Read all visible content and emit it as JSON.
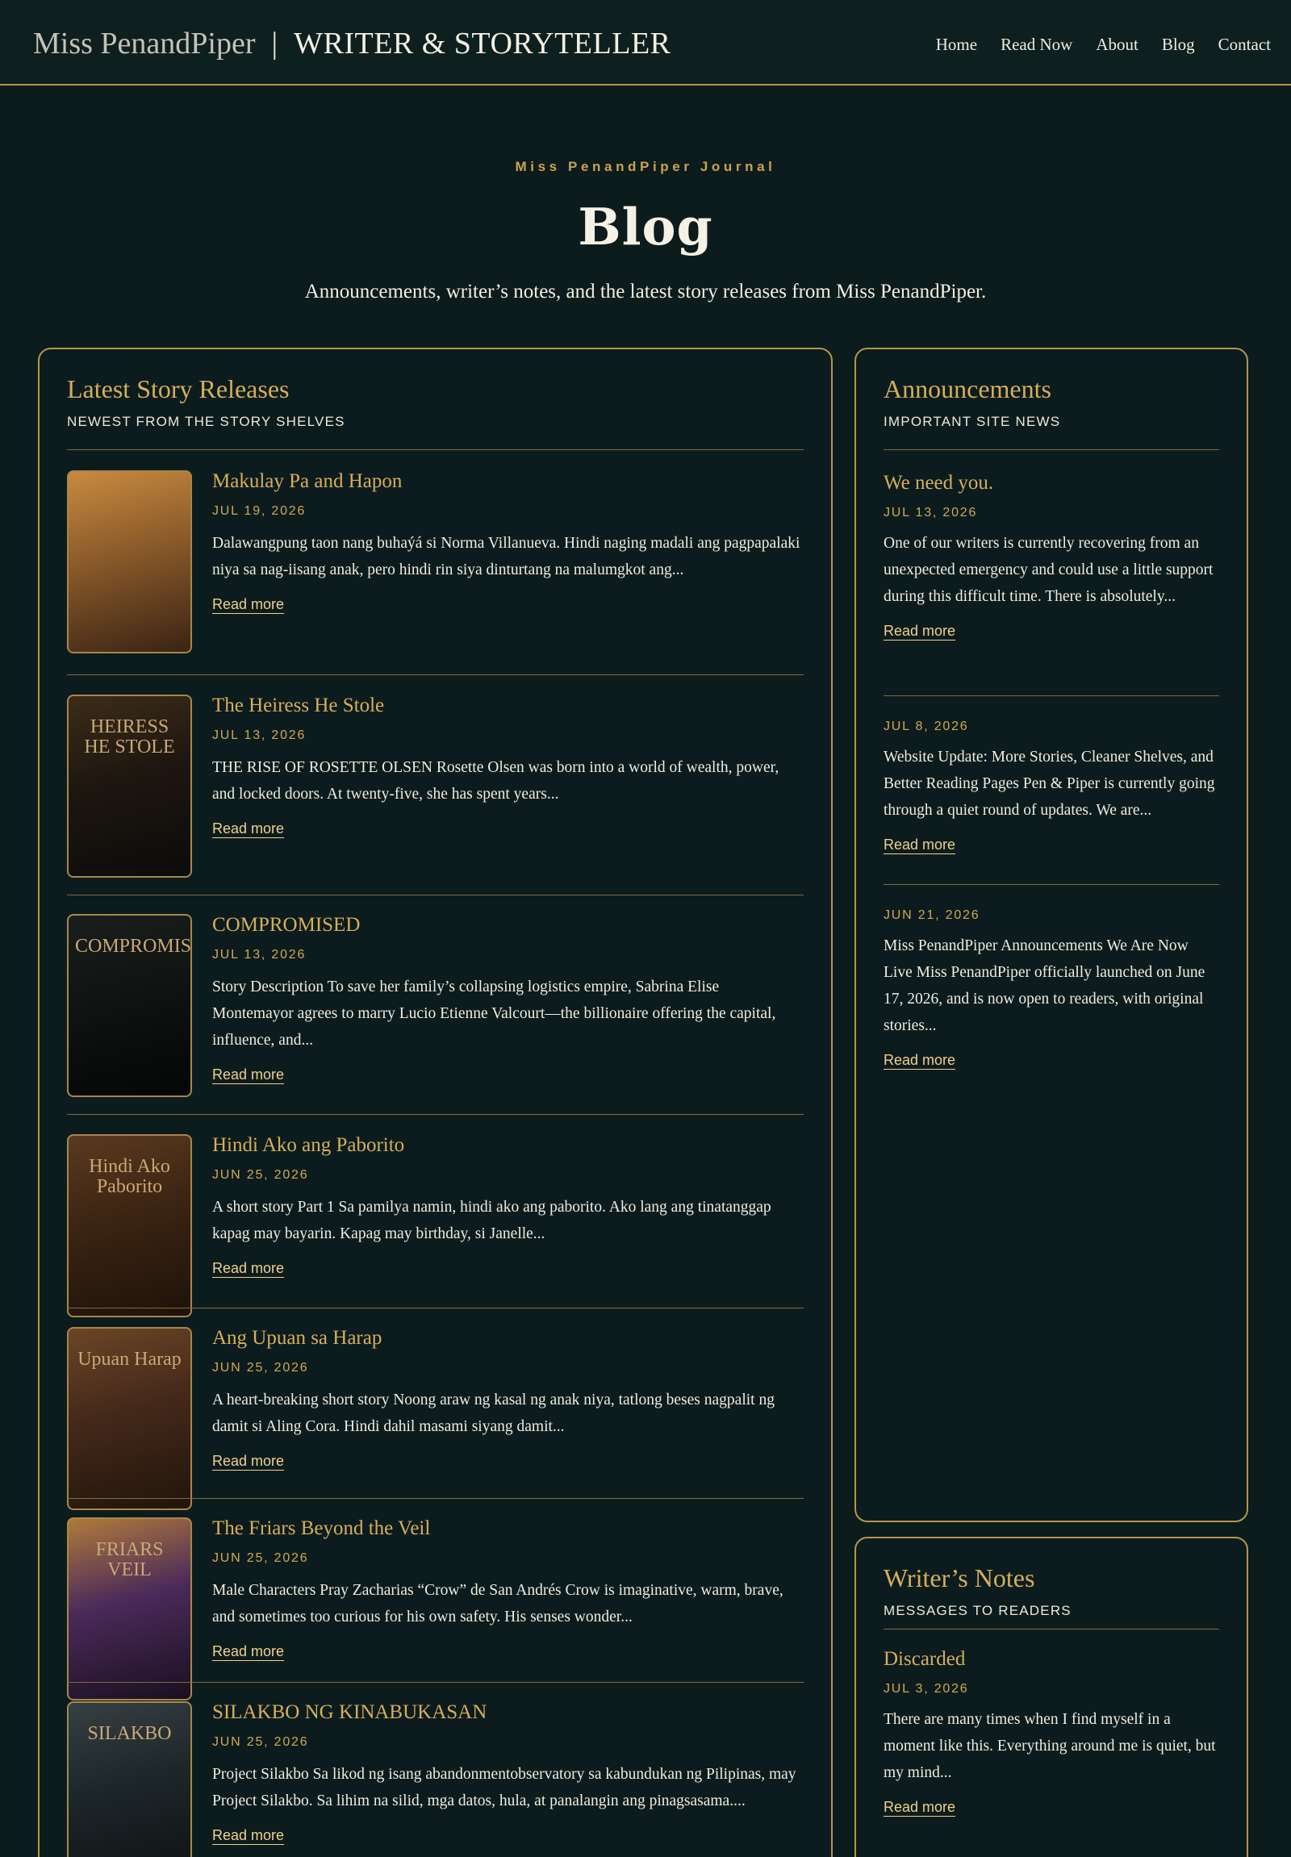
{
  "header": {
    "brand_name": "Miss PenandPiper",
    "brand_sep": "|",
    "brand_tagline": "WRITER & STORYTELLER",
    "nav": [
      "Home",
      "Read Now",
      "About",
      "Blog",
      "Contact"
    ]
  },
  "hero": {
    "kicker": "Miss PenandPiper Journal",
    "title": "Blog",
    "subtitle": "Announcements, writer’s notes, and the latest story releases from Miss PenandPiper."
  },
  "stories": {
    "title": "Latest Story Releases",
    "subtitle": "NEWEST FROM THE STORY SHELVES",
    "read_more": "Read more",
    "items": [
      {
        "title": "Makulay Pa and Hapon",
        "date": "JUL 19, 2026",
        "excerpt": "Dalawangpung taon nang buhaýá si Norma Villanueva. Hindi naging madali ang pagpapalaki niya sa nag-iisang anak, pero hindi rin siya dinturtang na malumgkot ang...",
        "cover_colors": [
          "#3a2414",
          "#8a5a2a",
          "#c98a3f"
        ]
      },
      {
        "title": "The Heiress He Stole",
        "date": "JUL 13, 2026",
        "excerpt": "THE RISE OF ROSETTE OLSEN Rosette Olsen was born into a world of wealth, power, and locked doors. At twenty-five, she has spent years...",
        "cover_colors": [
          "#0b0b0a",
          "#1e1710",
          "#3b2c18"
        ],
        "cover_text": "HEIRESS HE STOLE"
      },
      {
        "title": "COMPROMISED",
        "date": "JUL 13, 2026",
        "excerpt": "Story Description To save her family’s collapsing logistics empire, Sabrina Elise Montemayor agrees to marry Lucio Etienne Valcourt—the billionaire offering the capital, influence, and...",
        "cover_colors": [
          "#050606",
          "#0f1312",
          "#1a1f1d"
        ],
        "cover_text": "COMPROMISED"
      },
      {
        "title": "Hindi Ako ang Paborito",
        "date": "JUN 25, 2026",
        "excerpt": "A short story Part 1 Sa pamilya namin, hindi ako ang paborito. Ako lang ang tinatanggap kapag may bayarin. Kapag may birthday, si Janelle...",
        "cover_colors": [
          "#1e120a",
          "#3b2412",
          "#5a3a1f"
        ],
        "cover_text": "Hindi Ako Paborito"
      },
      {
        "title": "Ang Upuan sa Harap",
        "date": "JUN 25, 2026",
        "excerpt": "A heart-breaking short story Noong araw ng kasal ng anak niya, tatlong beses nagpalit ng damit si Aling Cora. Hindi dahil masami siyang damit...",
        "cover_colors": [
          "#22150b",
          "#44291a",
          "#6b4526"
        ],
        "cover_text": "Upuan Harap"
      },
      {
        "title": "The Friars Beyond the Veil",
        "date": "JUN 25, 2026",
        "excerpt": "Male Characters Pray Zacharias “Crow” de San Andrés Crow is imaginative, warm, brave, and sometimes too curious for his own safety. His senses wonder...",
        "cover_colors": [
          "#1a1020",
          "#4b2a5a",
          "#b07a3a"
        ],
        "cover_text": "FRIARS VEIL"
      },
      {
        "title": "SILAKBO NG KINABUKASAN",
        "date": "JUN 25, 2026",
        "excerpt": "Project Silakbo Sa likod ng isang abandonmentobservatory sa kabundukan ng Pilipinas, may Project Silakbo. Sa lihim na silid, mga datos, hula, at panalangin ang pinagsasama....",
        "cover_colors": [
          "#0d1214",
          "#1d2629",
          "#363f42"
        ],
        "cover_text": "SILAKBO"
      }
    ]
  },
  "announcements": {
    "title": "Announcements",
    "subtitle": "IMPORTANT SITE NEWS",
    "read_more": "Read more",
    "items": [
      {
        "title": "We need you.",
        "date": "JUL 13, 2026",
        "excerpt": "One of our writers is currently recovering from an unexpected emergency and could use a little support during this difficult time. There is absolutely..."
      },
      {
        "title": "",
        "date": "JUL 8, 2026",
        "excerpt": "Website Update: More Stories, Cleaner Shelves, and Better Reading Pages Pen & Piper is currently going through a quiet round of updates. We are..."
      },
      {
        "title": "",
        "date": "JUN 21, 2026",
        "excerpt": "Miss PenandPiper Announcements We Are Now Live Miss PenandPiper officially launched on June 17, 2026, and is now open to readers, with original stories..."
      }
    ]
  },
  "notes": {
    "title": "Writer’s Notes",
    "subtitle": "MESSAGES TO READERS",
    "read_more": "Read more",
    "items": [
      {
        "title": "Discarded",
        "date": "JUL 3, 2026",
        "excerpt": "There are many times when I find myself in a moment like this. Everything around me is quiet, but my mind..."
      }
    ]
  }
}
